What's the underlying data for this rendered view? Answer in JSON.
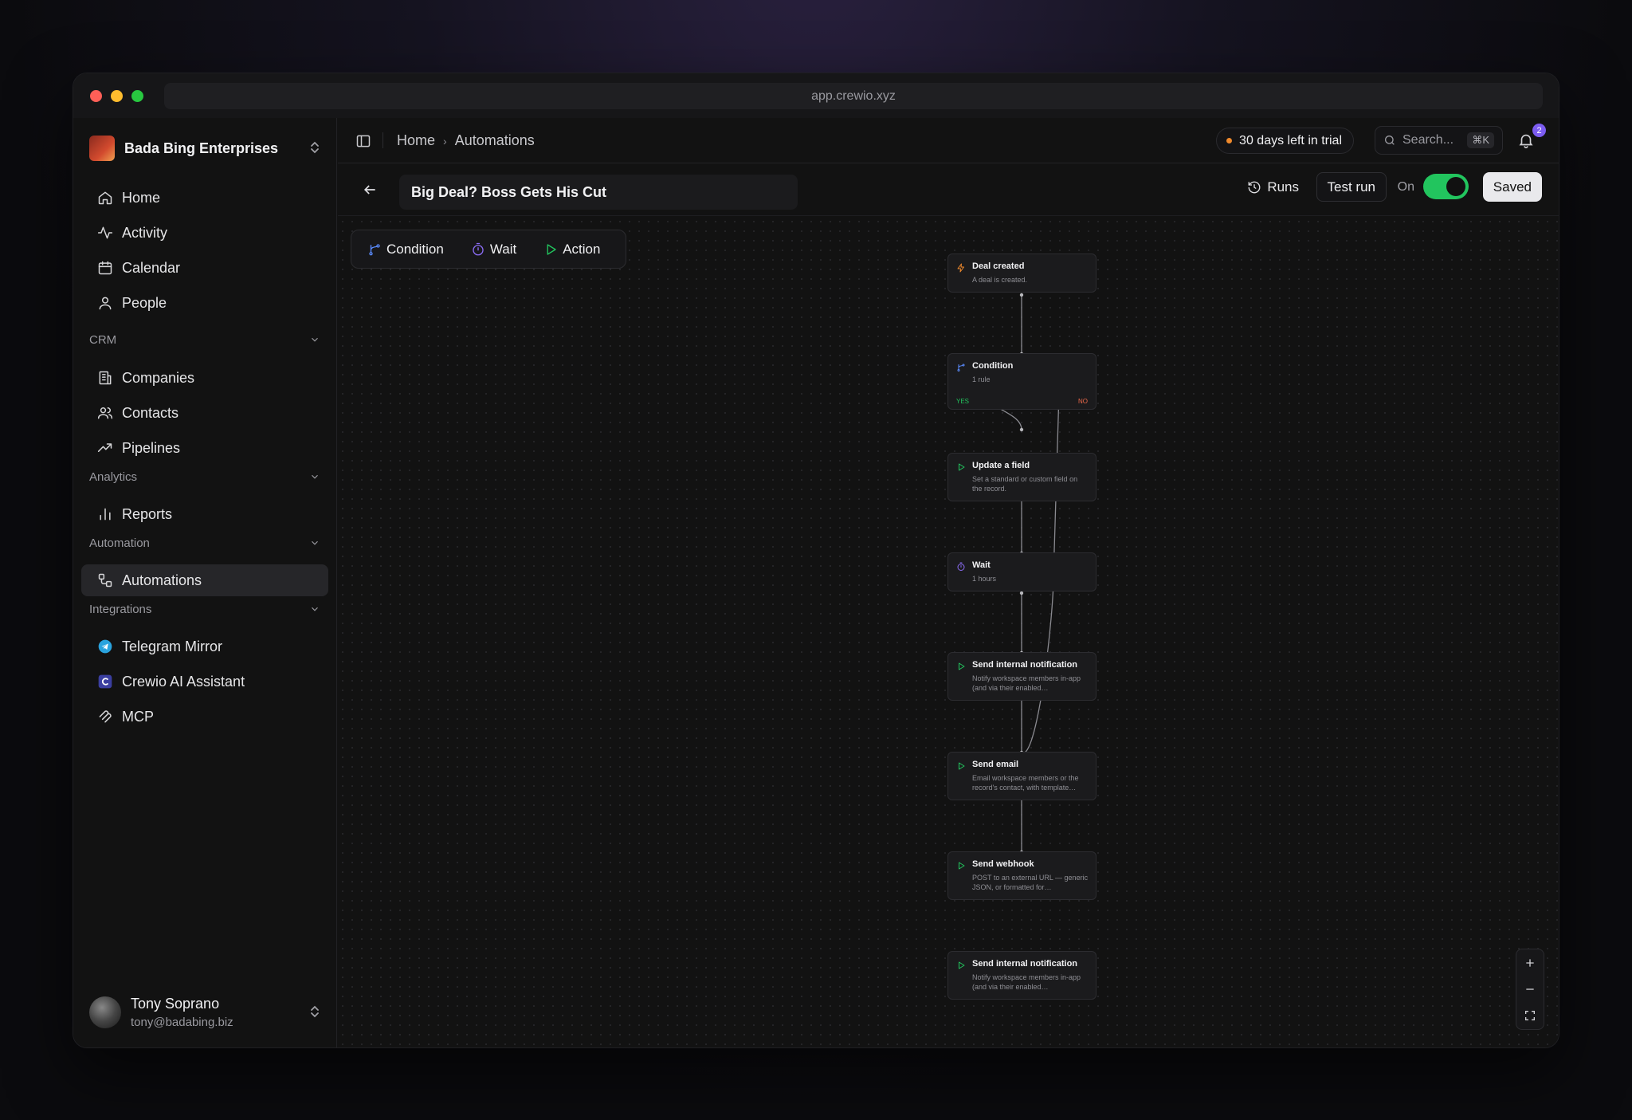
{
  "browser": {
    "url": "app.crewio.xyz"
  },
  "workspace": {
    "name": "Bada Bing Enterprises"
  },
  "nav": {
    "home": "Home",
    "activity": "Activity",
    "calendar": "Calendar",
    "people": "People",
    "crm_label": "CRM",
    "companies": "Companies",
    "contacts": "Contacts",
    "pipelines": "Pipelines",
    "analytics_label": "Analytics",
    "reports": "Reports",
    "automation_label": "Automation",
    "automations": "Automations",
    "integrations_label": "Integrations",
    "telegram": "Telegram Mirror",
    "crewio_ai": "Crewio AI Assistant",
    "mcp": "MCP"
  },
  "user": {
    "name": "Tony Soprano",
    "email": "tony@badabing.biz"
  },
  "topbar": {
    "breadcrumb": [
      "Home",
      "Automations"
    ],
    "trial": "30 days left in trial",
    "search_placeholder": "Search...",
    "search_shortcut": "⌘K",
    "notification_count": "2"
  },
  "editor": {
    "title": "Big Deal? Boss Gets His Cut",
    "runs": "Runs",
    "test_run": "Test run",
    "on_label": "On",
    "enabled": true,
    "saved": "Saved"
  },
  "palette": {
    "condition": "Condition",
    "wait": "Wait",
    "action": "Action"
  },
  "colors": {
    "accent_green": "#22c55e",
    "badge_purple": "#7c5cf0",
    "trial_dot": "#f08a2c"
  },
  "nodes": [
    {
      "title": "Deal created",
      "desc": "A deal is created.",
      "icon": "zap-icon"
    },
    {
      "title": "Condition",
      "desc": "1 rule",
      "icon": "branch-icon",
      "yes": "YES",
      "no": "NO"
    },
    {
      "title": "Update a field",
      "desc": "Set a standard or custom field on the record.",
      "icon": "play-icon"
    },
    {
      "title": "Wait",
      "desc": "1 hours",
      "icon": "timer-icon"
    },
    {
      "title": "Send internal notification",
      "desc": "Notify workspace members in-app (and via their enabled…",
      "icon": "play-icon"
    },
    {
      "title": "Send email",
      "desc": "Email workspace members or the record's contact, with template…",
      "icon": "play-icon"
    },
    {
      "title": "Send webhook",
      "desc": "POST to an external URL — generic JSON, or formatted for…",
      "icon": "play-icon"
    },
    {
      "title": "Send internal notification",
      "desc": "Notify workspace members in-app (and via their enabled…",
      "icon": "play-icon"
    }
  ]
}
